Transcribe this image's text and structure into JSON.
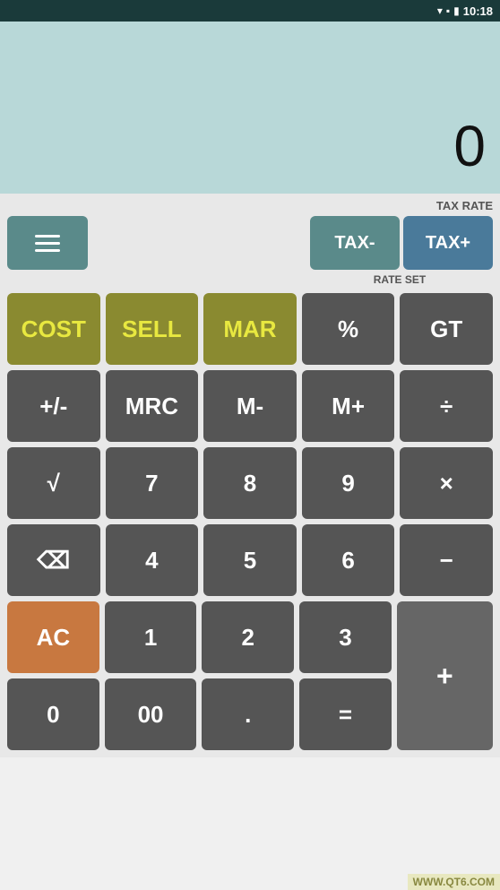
{
  "statusBar": {
    "time": "10:18",
    "wifiIcon": "▼",
    "batteryIcon": "🔋"
  },
  "display": {
    "value": "0"
  },
  "taxRateLabel": "TAX RATE",
  "rateSetLabel": "RATE SET",
  "buttons": {
    "menu": "☰",
    "taxMinus": "TAX-",
    "taxPlus": "TAX+",
    "cost": "COST",
    "sell": "SELL",
    "mar": "MAR",
    "percent": "%",
    "gt": "GT",
    "plusMinus": "+/-",
    "mrc": "MRC",
    "mMinus": "M-",
    "mPlus": "M+",
    "divide": "÷",
    "sqrt": "√",
    "seven": "7",
    "eight": "8",
    "nine": "9",
    "multiply": "×",
    "backspace": "⌫",
    "four": "4",
    "five": "5",
    "six": "6",
    "minus": "−",
    "ac": "AC",
    "one": "1",
    "two": "2",
    "three": "3",
    "plus": "+",
    "zero": "0",
    "doubleZero": "00",
    "dot": ".",
    "equals": "="
  },
  "watermark": "WWW.QT6.COM"
}
